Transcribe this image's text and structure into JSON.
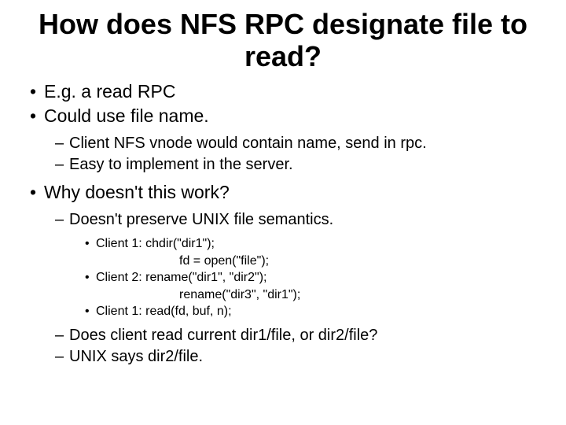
{
  "title": "How does NFS RPC designate file to read?",
  "b1": "E.g. a read RPC",
  "b2": "Could use file name.",
  "b2s1": "Client NFS vnode would contain name, send in rpc.",
  "b2s2": "Easy to implement in the server.",
  "b3": "Why doesn't this work?",
  "b3s1": "Doesn't preserve UNIX file semantics.",
  "c1": "Client 1: chdir(\"dir1\");",
  "c1b": "fd = open(\"file\");",
  "c2": "Client 2: rename(\"dir1\", \"dir2\");",
  "c2b": "rename(\"dir3\", \"dir1\");",
  "c3": "Client 1: read(fd, buf, n);",
  "b3s2": "Does client read current dir1/file, or dir2/file?",
  "b3s3": "UNIX says dir2/file."
}
